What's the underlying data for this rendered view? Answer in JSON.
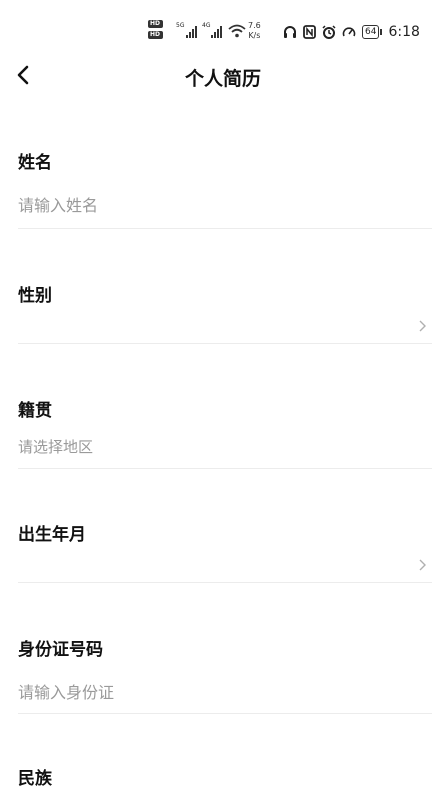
{
  "status_bar": {
    "net1": "5G",
    "net2": "4G",
    "speed_value": "7.6",
    "speed_unit": "K/s",
    "battery": "64",
    "time": "6:18"
  },
  "header": {
    "title": "个人简历"
  },
  "form": {
    "name": {
      "label": "姓名",
      "placeholder": "请输入姓名"
    },
    "gender": {
      "label": "性别",
      "placeholder": ""
    },
    "native_place": {
      "label": "籍贯",
      "placeholder": "请选择地区"
    },
    "birth": {
      "label": "出生年月",
      "placeholder": ""
    },
    "id_number": {
      "label": "身份证号码",
      "placeholder": "请输入身份证"
    },
    "ethnicity": {
      "label": "民族"
    }
  }
}
